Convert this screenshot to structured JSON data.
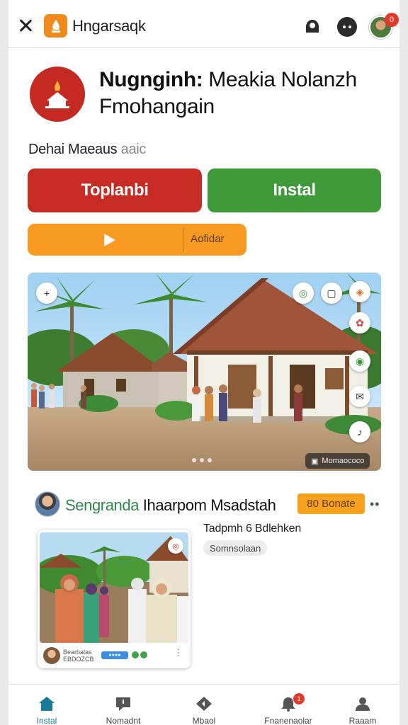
{
  "header": {
    "app_name": "Hngarsaqk",
    "notification_count": "0"
  },
  "app": {
    "title_bold": "Nugnginh:",
    "title_rest": " Meakia Nolanzh Fmohangain",
    "developer": "Dehai Maeaus",
    "developer_suffix": " aaic"
  },
  "actions": {
    "primary_label": "Toplanbi",
    "install_label": "Instal",
    "trailer_label": "Aofidar"
  },
  "screenshot": {
    "tag_label": "Momaococo",
    "badges": [
      "+",
      "◎",
      "▢",
      "◈",
      "✿",
      "◉",
      "✉",
      "♪"
    ]
  },
  "post": {
    "name_colored": "Sengranda",
    "name_rest": " Ihaarpom Msadstah",
    "button_label": "80 Bonate",
    "more": "••",
    "subtitle": "Tadpmh 6 Bdlehken",
    "chip": "Somnsolaan",
    "card_footer_text": "Bearbalas\nEBDOZCB",
    "card_chip": "●●●●"
  },
  "bottom_nav": {
    "items": [
      {
        "label": "Instal",
        "icon": "home-icon"
      },
      {
        "label": "Nomadnt",
        "icon": "message-icon"
      },
      {
        "label": "Mbaol",
        "icon": "diamond-icon"
      },
      {
        "label": "Fnanenaolar",
        "icon": "bell-icon",
        "badge": "1"
      },
      {
        "label": "Raaam",
        "icon": "profile-icon"
      }
    ]
  },
  "colors": {
    "accent_red": "#c72c24",
    "accent_green": "#3f9b3a",
    "accent_orange": "#f89a22",
    "active_nav": "#1a7a99"
  }
}
